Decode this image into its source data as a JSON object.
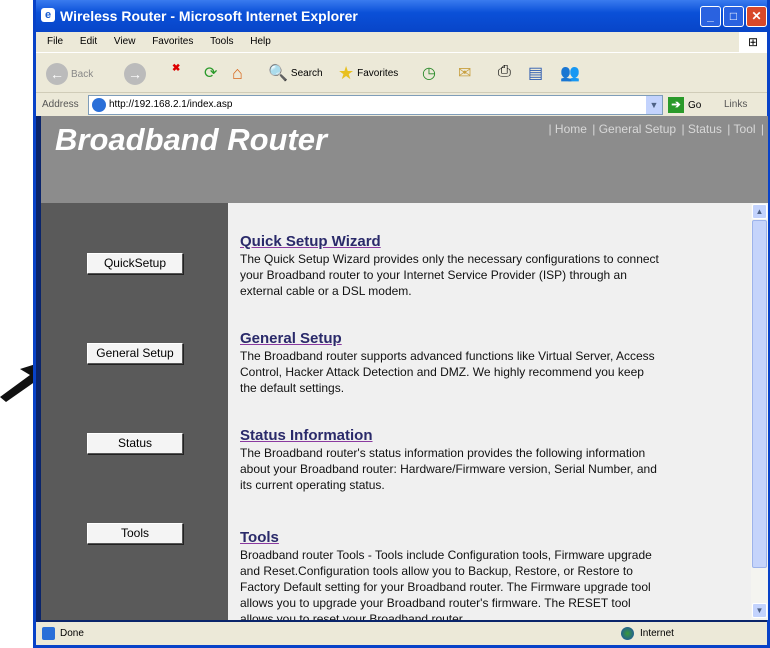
{
  "window": {
    "title": "Wireless Router - Microsoft Internet Explorer"
  },
  "menu": [
    "File",
    "Edit",
    "View",
    "Favorites",
    "Tools",
    "Help"
  ],
  "toolbar": {
    "back": "Back",
    "search": "Search",
    "favorites": "Favorites"
  },
  "address": {
    "label": "Address",
    "url": "http://192.168.2.1/index.asp",
    "go": "Go",
    "links": "Links"
  },
  "page": {
    "title": "Broadband Router",
    "nav": [
      "| Home",
      "| General Setup",
      "| Status",
      "| Tool",
      "|"
    ],
    "buttons": [
      "QuickSetup",
      "General Setup",
      "Status",
      "Tools"
    ],
    "sections": [
      {
        "heading": "Quick Setup Wizard",
        "text": "The Quick Setup Wizard provides only the necessary configurations to connect your Broadband router to your Internet Service Provider (ISP) through an external cable or a DSL modem."
      },
      {
        "heading": "General Setup",
        "text": "The Broadband router supports advanced functions like Virtual Server, Access Control, Hacker Attack Detection and DMZ. We highly recommend you keep the default settings."
      },
      {
        "heading": "Status Information",
        "text": "The Broadband router's status information provides the following information about your Broadband router: Hardware/Firmware version, Serial Number, and its current operating status."
      },
      {
        "heading": "Tools",
        "text": "Broadband router Tools - Tools include Configuration tools, Firmware upgrade and Reset.Configuration tools allow you to Backup, Restore, or Restore to Factory Default setting for your Broadband router. The Firmware upgrade tool allows you to upgrade your Broadband router's firmware. The RESET tool allows you to reset your Broadband router."
      }
    ]
  },
  "status": {
    "left": "Done",
    "zone": "Internet"
  }
}
